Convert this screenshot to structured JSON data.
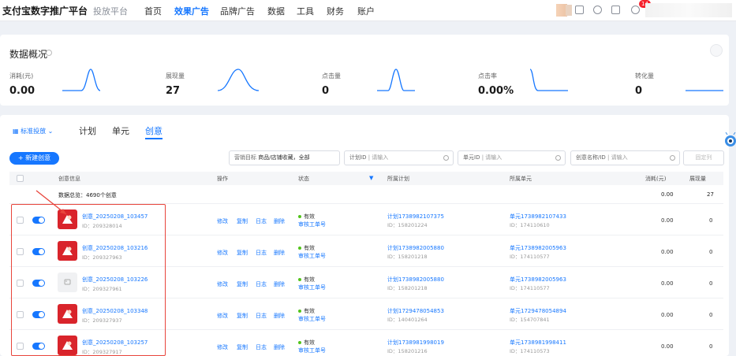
{
  "topbar": {
    "brand": "支付宝数字推广平台",
    "sub_brand": "投放平台",
    "nav": [
      "首页",
      "效果广告",
      "品牌广告",
      "数据",
      "工具",
      "财务",
      "账户"
    ],
    "active_nav": "效果广告",
    "notification_count": "14"
  },
  "overview": {
    "title": "数据概况",
    "metrics": [
      {
        "label": "消耗(元)",
        "value": "0.00"
      },
      {
        "label": "展现量",
        "value": "27"
      },
      {
        "label": "点击量",
        "value": "0"
      },
      {
        "label": "点击率",
        "value": "0.00%"
      },
      {
        "label": "转化量",
        "value": "0"
      }
    ]
  },
  "main": {
    "level_select": "标准投放",
    "tabs": [
      "计划",
      "单元",
      "创意"
    ],
    "active_tab": "创意",
    "new_button": "+ 新建创意",
    "filters": {
      "marketing_goal_label": "营销目标",
      "marketing_goal_value": "商品/店铺收藏，全部",
      "plan_id_label": "计划ID",
      "plan_id_placeholder": "请输入",
      "unit_id_label": "单元ID",
      "unit_id_placeholder": "请输入",
      "creative_name_label": "创意名称/ID",
      "creative_name_placeholder": "请输入",
      "fixed_column": "固定列"
    },
    "table": {
      "headers": [
        "创意信息",
        "操作",
        "状态",
        "所属计划",
        "所属单元",
        "消耗(元)",
        "展现量"
      ],
      "total_label": "数据总览：4690个创意",
      "total_cost": "0.00",
      "total_impressions": "27",
      "ops": [
        "修改",
        "复制",
        "日志",
        "删除"
      ],
      "rows": [
        {
          "name": "创意_20250208_103457",
          "id": "ID：209328014",
          "status": "有效",
          "ticket": "审核工单号",
          "plan": "计划1738982107375",
          "plan_id": "ID：158201224",
          "unit": "单元1738982107433",
          "unit_id": "ID：174110610",
          "cost": "0.00",
          "impressions": "0"
        },
        {
          "name": "创意_20250208_103216",
          "id": "ID：209327963",
          "status": "有效",
          "ticket": "审核工单号",
          "plan": "计划1738982005880",
          "plan_id": "ID：158201218",
          "unit": "单元1738982005963",
          "unit_id": "ID：174110577",
          "cost": "0.00",
          "impressions": "0"
        },
        {
          "name": "创意_20250208_103226",
          "id": "ID：209327961",
          "status": "有效",
          "ticket": "审核工单号",
          "plan": "计划1738982005880",
          "plan_id": "ID：158201218",
          "unit": "单元1738982005963",
          "unit_id": "ID：174110577",
          "cost": "0.00",
          "impressions": "0"
        },
        {
          "name": "创意_20250208_103348",
          "id": "ID：209327937",
          "status": "有效",
          "ticket": "审核工单号",
          "plan": "计划1729478054853",
          "plan_id": "ID：140401264",
          "unit": "单元1729478054894",
          "unit_id": "ID：154707841",
          "cost": "0.00",
          "impressions": "0"
        },
        {
          "name": "创意_20250208_103257",
          "id": "ID：209327917",
          "status": "有效",
          "ticket": "审核工单号",
          "plan": "计划1738981998019",
          "plan_id": "ID：158201216",
          "unit": "单元1738981998411",
          "unit_id": "ID：174110573",
          "cost": "0.00",
          "impressions": "0"
        }
      ]
    }
  }
}
